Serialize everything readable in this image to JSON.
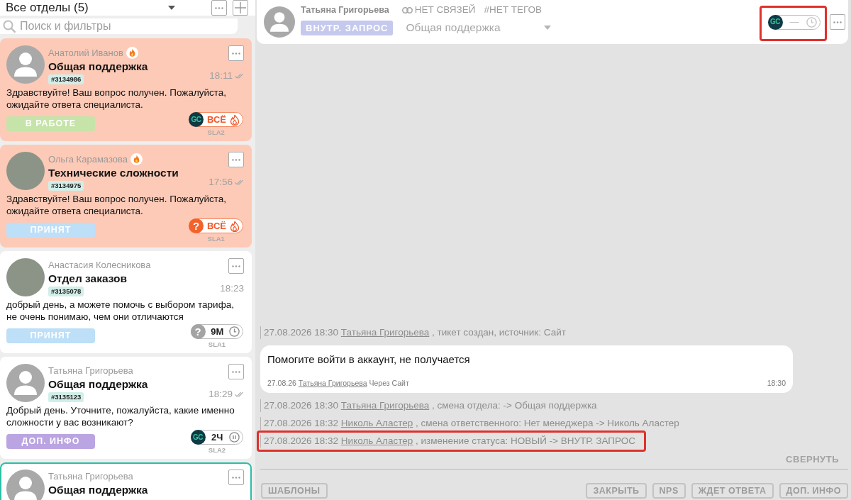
{
  "sidebar": {
    "department_filter": "Все отделы (5)",
    "search": {
      "placeholder": "Поиск и фильтры"
    },
    "tickets": [
      {
        "customer": "Анатолий Иванов",
        "urgent": true,
        "overdue": true,
        "selected": false,
        "avatar": {
          "kind": "default"
        },
        "department": "Общая поддержка",
        "number": "#3134986",
        "time": "18:11",
        "read": true,
        "message": "Здравствуйте! Ваш вопрос получен. Пожалуйста, ожидайте ответа специалиста.",
        "status": {
          "label": "В РАБОТЕ",
          "color": "#c6e3a9"
        },
        "sla": {
          "agent": {
            "kind": "logo",
            "text": "GC"
          },
          "kind": "overdue",
          "value": "ВСЁ",
          "label": "SLA2"
        }
      },
      {
        "customer": "Ольга Карамазова",
        "urgent": true,
        "overdue": true,
        "selected": false,
        "avatar": {
          "kind": "photo"
        },
        "department": "Технические сложности",
        "number": "#3134975",
        "time": "17:56",
        "read": true,
        "message": "Здравствуйте! Ваш вопрос получен. Пожалуйста, ожидайте ответа специалиста.",
        "status": {
          "label": "ПРИНЯТ",
          "color": "#bddff7"
        },
        "sla": {
          "agent": {
            "kind": "unassigned",
            "text": "?"
          },
          "kind": "overdue",
          "value": "ВСЁ",
          "label": "SLA1"
        }
      },
      {
        "customer": "Анастасия Колесникова",
        "urgent": false,
        "overdue": false,
        "selected": false,
        "avatar": {
          "kind": "photo"
        },
        "department": "Отдел заказов",
        "number": "#3135078",
        "time": "18:23",
        "read": false,
        "message": "добрый день, а можете помочь с выбором тарифа, не очень понимаю, чем они отличаются",
        "status": {
          "label": "ПРИНЯТ",
          "color": "#bddff7"
        },
        "sla": {
          "agent": {
            "kind": "unassigned",
            "text": "?"
          },
          "kind": "timer",
          "value": "9М",
          "label": "SLA1"
        }
      },
      {
        "customer": "Татьяна Григорьева",
        "urgent": false,
        "overdue": false,
        "selected": false,
        "avatar": {
          "kind": "default"
        },
        "department": "Общая поддержка",
        "number": "#3135123",
        "time": "18:29",
        "read": true,
        "message": "Добрый день. Уточните, пожалуйста, какие именно сложности у вас возникают?",
        "status": {
          "label": "ДОП. ИНФО",
          "color": "#bba4e2"
        },
        "sla": {
          "agent": {
            "kind": "logo",
            "text": "GC"
          },
          "kind": "paused",
          "value": "2Ч",
          "label": "SLA2"
        }
      },
      {
        "customer": "Татьяна Григорьева",
        "urgent": false,
        "overdue": false,
        "selected": true,
        "avatar": {
          "kind": "default"
        },
        "department": "Общая поддержка"
      }
    ]
  },
  "ticket_header": {
    "customer": "Татьяна Григорьева",
    "links": "НЕТ СВЯЗЕЙ",
    "tags": "#НЕТ ТЕГОВ",
    "status": {
      "label": "ВНУТР. ЗАПРОС",
      "color": "#c6c9ee"
    },
    "department": "Общая поддержка",
    "sla": {
      "agent": {
        "kind": "logo",
        "text": "GC"
      },
      "kind": "timer",
      "value": "—",
      "highlighted": true
    }
  },
  "timeline": [
    {
      "kind": "event",
      "datetime": "27.08.2026 18:30",
      "author": "Татьяна Григорьева",
      "text": ", тикет создан, источник: Сайт",
      "highlighted": false
    },
    {
      "kind": "message",
      "text": "Помогите войти в аккаунт, не получается",
      "date": "27.08.26",
      "author": "Татьяна Григорьева",
      "channel": "Через Сайт",
      "time": "18:30",
      "highlighted": false
    },
    {
      "kind": "event",
      "datetime": "27.08.2026 18:30",
      "author": "Татьяна Григорьева",
      "text": ", смена отдела: -> Общая поддержка",
      "highlighted": false
    },
    {
      "kind": "event",
      "datetime": "27.08.2026 18:32",
      "author": "Николь Аластер",
      "text": ", смена ответственного: Нет менеджера -> Николь Аластер",
      "highlighted": false
    },
    {
      "kind": "event",
      "datetime": "27.08.2026 18:32",
      "author": "Николь Аластер",
      "text": ", изменение статуса: НОВЫЙ -> ВНУТР. ЗАПРОС",
      "highlighted": true
    }
  ],
  "collapse_link": "СВЕРНУТЬ",
  "composer": {
    "templates_button": "ШАБЛОНЫ",
    "actions": [
      "ЗАКРЫТЬ",
      "NPS",
      "ЖДЕТ ОТВЕТА",
      "ДОП. ИНФО"
    ]
  }
}
